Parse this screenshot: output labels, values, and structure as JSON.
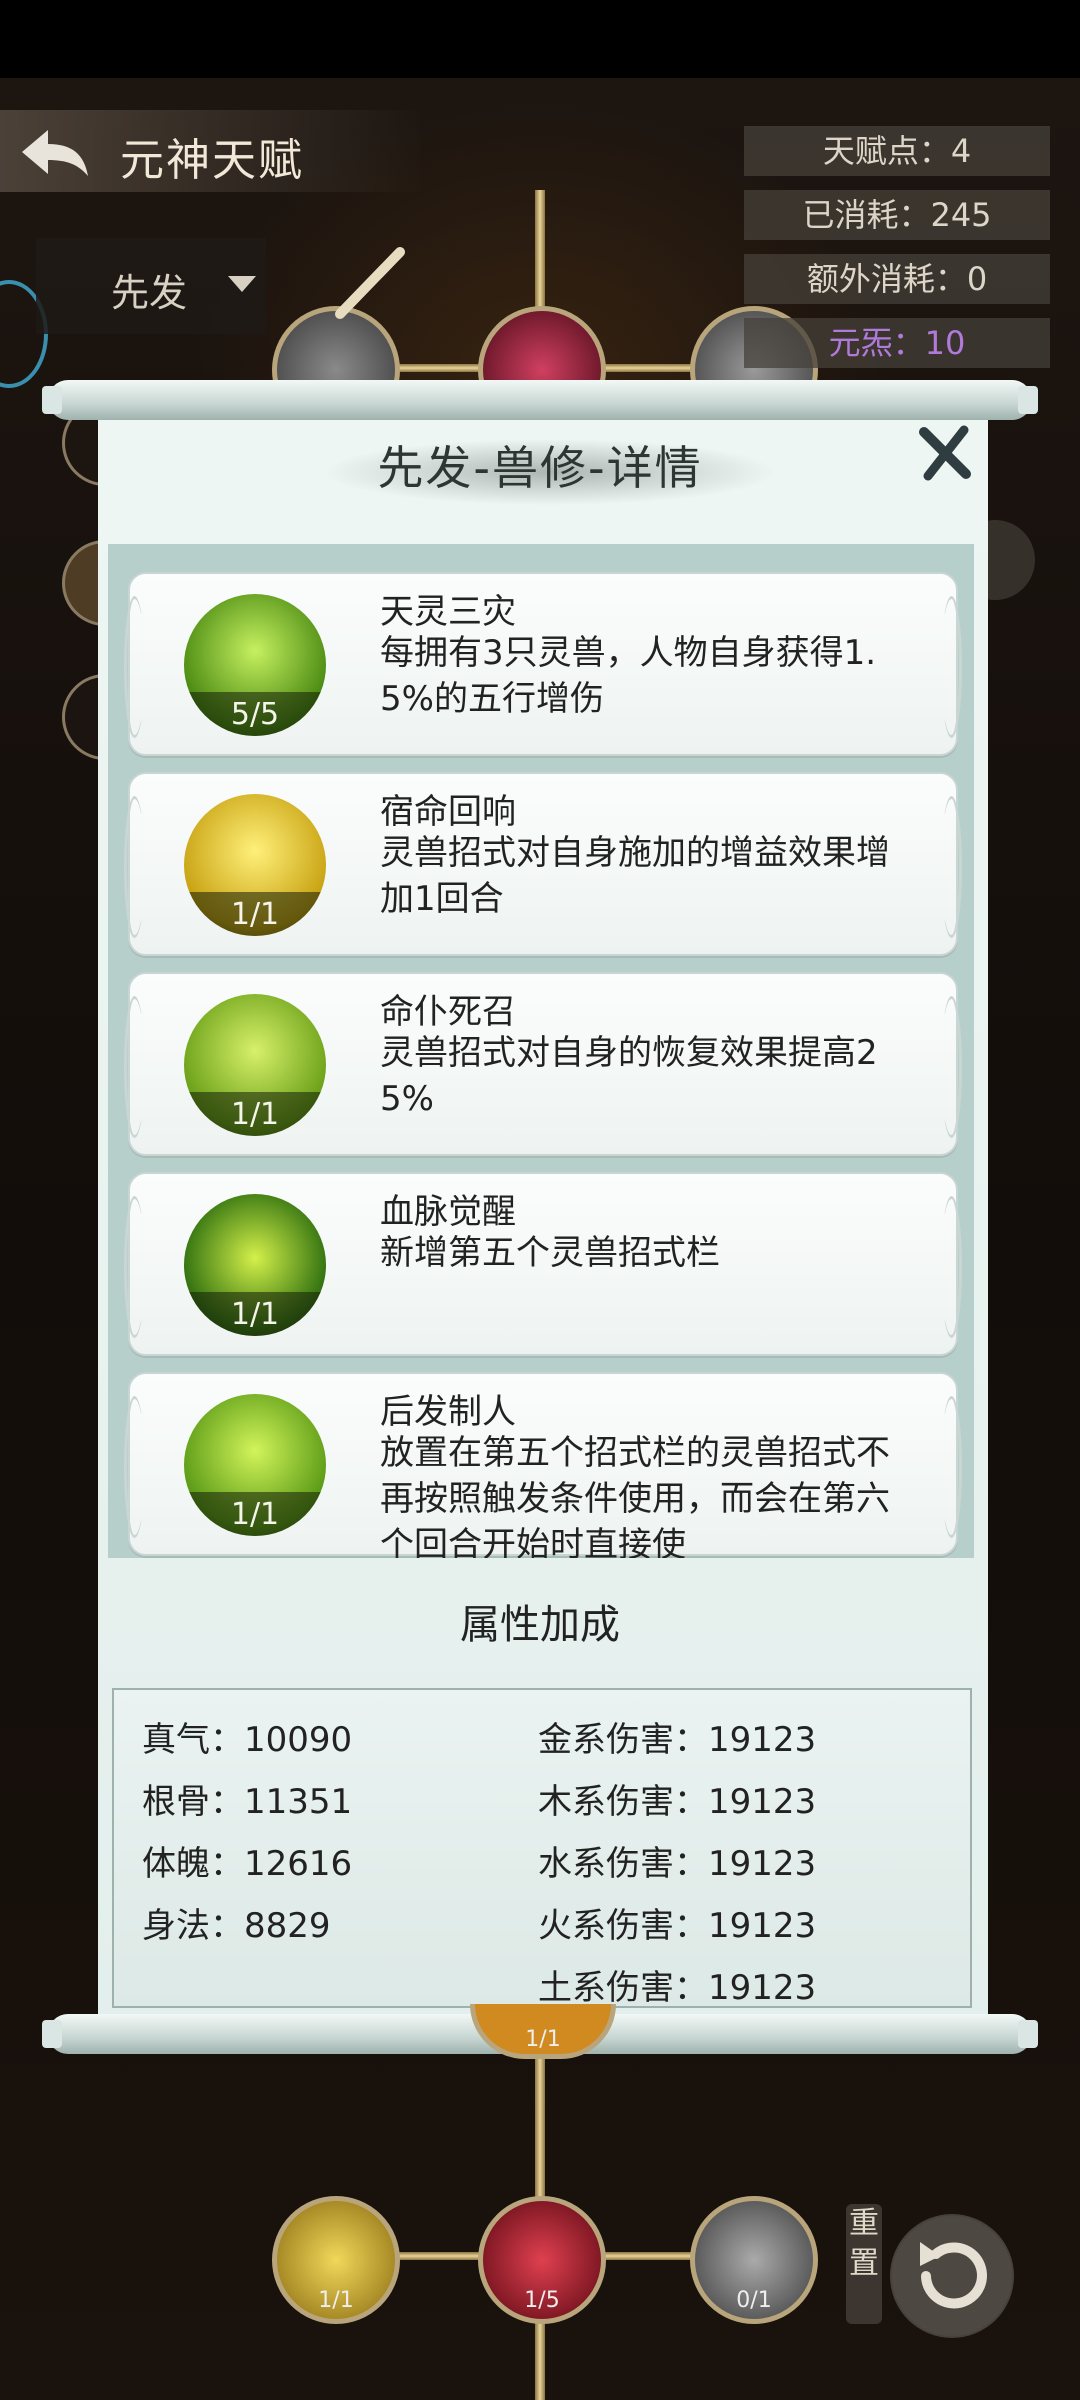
{
  "header": {
    "title": "元神天赋",
    "filter_label": "先发",
    "stats": [
      "天赋点：4",
      "已消耗：245",
      "额外消耗：0"
    ],
    "element_label": "元炁：10"
  },
  "dialog": {
    "title": "先发-兽修-详情",
    "skills": [
      {
        "name": "天灵三灾",
        "desc": "每拥有3只灵兽，人物自身获得1.5%的五行增伤",
        "level": "5/5"
      },
      {
        "name": "宿命回响",
        "desc": "灵兽招式对自身施加的增益效果增加1回合",
        "level": "1/1"
      },
      {
        "name": "命仆死召",
        "desc": "灵兽招式对自身的恢复效果提高25%",
        "level": "1/1"
      },
      {
        "name": "血脉觉醒",
        "desc": "新增第五个灵兽招式栏",
        "level": "1/1"
      },
      {
        "name": "后发制人",
        "desc": "放置在第五个招式栏的灵兽招式不再按照触发条件使用，而会在第六个回合开始时直接使",
        "level": "1/1"
      }
    ],
    "attr_title": "属性加成",
    "attrs_left": [
      "真气：10090",
      "根骨：11351",
      "体魄：12616",
      "身法：8829"
    ],
    "attrs_right": [
      "金系伤害：19123",
      "木系伤害：19123",
      "水系伤害：19123",
      "火系伤害：19123",
      "土系伤害：19123"
    ]
  },
  "tree": {
    "hidden_node_count": "1/1",
    "bottom_nodes": [
      "1/1",
      "1/5",
      "0/1"
    ],
    "reset_label": "重置"
  },
  "colors": {
    "accent_purple": "#b07ad8",
    "scroll_paper": "#e3efec",
    "gold_line": "#e8d49a"
  }
}
